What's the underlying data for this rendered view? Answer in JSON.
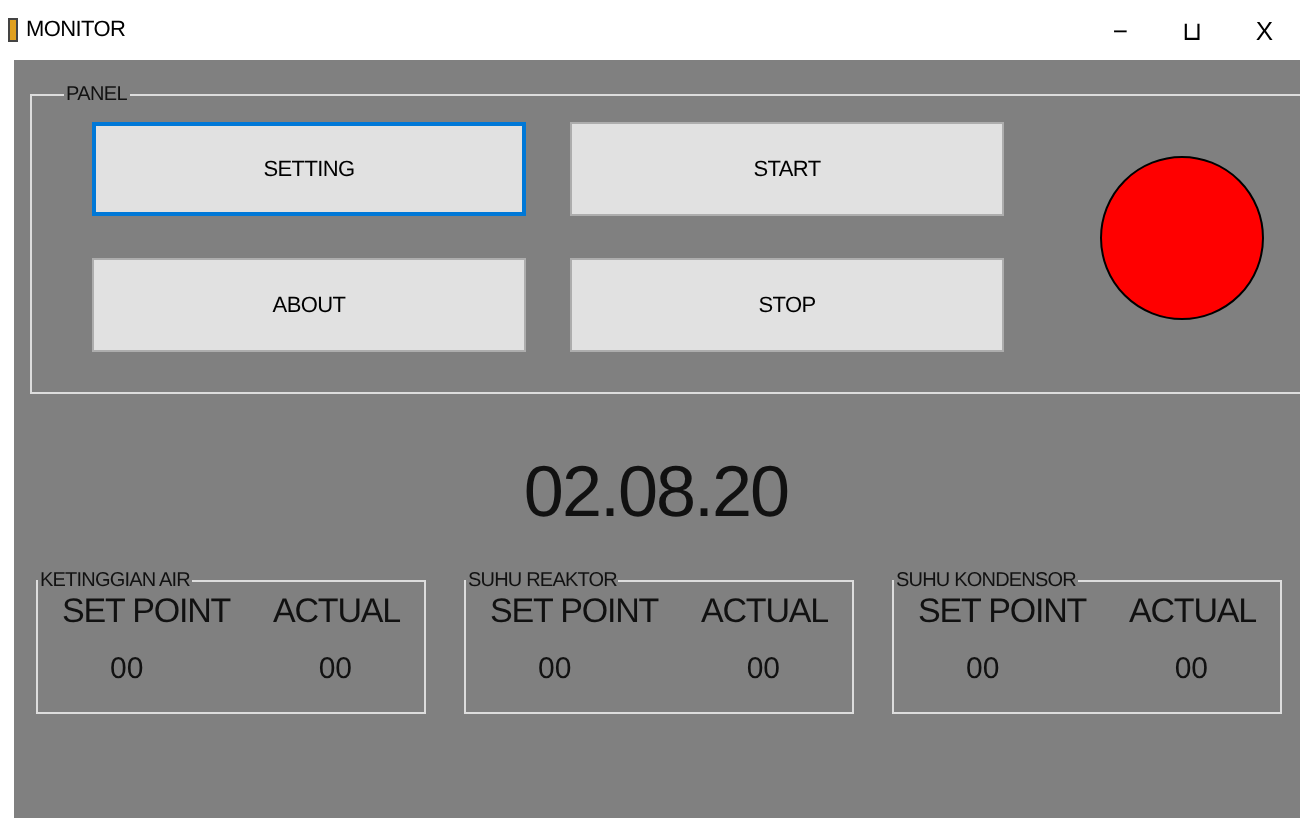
{
  "window": {
    "title": "MONITOR",
    "controls": [
      "−",
      "⊔",
      "X"
    ]
  },
  "panel": {
    "title": "PANEL",
    "buttons": [
      {
        "label": "SETTING",
        "focused": true
      },
      {
        "label": "START",
        "focused": false
      },
      {
        "label": "ABOUT",
        "focused": false
      },
      {
        "label": "STOP",
        "focused": false
      }
    ],
    "indicator": {
      "color": "#ff0000"
    }
  },
  "date": "02.08.20",
  "groups": [
    {
      "title": "KETINGGIAN AIR",
      "column_1": "SET POINT",
      "column_2": "ACTUAL",
      "value_1": "00",
      "value_2": "00"
    },
    {
      "title": "SUHU REAKTOR",
      "column_1": "SET POINT",
      "column_2": "ACTUAL",
      "value_1": "00",
      "value_2": "00"
    },
    {
      "title": "SUHU KONDENSOR",
      "column_1": "SET POINT",
      "column_2": "ACTUAL",
      "value_1": "00",
      "value_2": "00"
    }
  ]
}
